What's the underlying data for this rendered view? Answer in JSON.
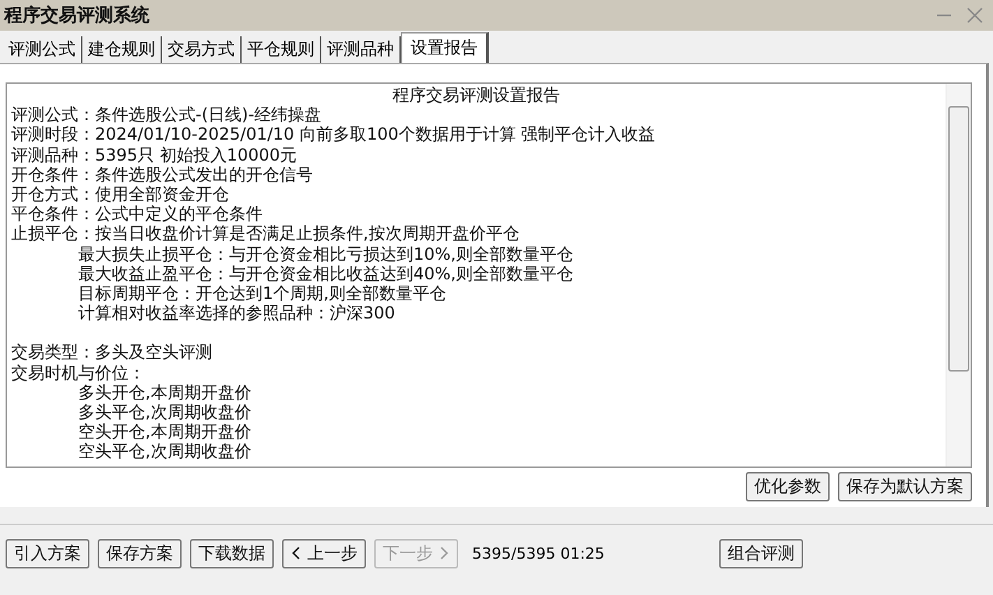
{
  "window": {
    "title": "程序交易评测系统"
  },
  "tabs": [
    {
      "label": "评测公式",
      "selected": false
    },
    {
      "label": "建仓规则",
      "selected": false
    },
    {
      "label": "交易方式",
      "selected": false
    },
    {
      "label": "平仓规则",
      "selected": false
    },
    {
      "label": "评测品种",
      "selected": false
    },
    {
      "label": "设置报告",
      "selected": true
    }
  ],
  "report": {
    "title": "程序交易评测设置报告",
    "groups": [
      [
        {
          "text": "评测公式：条件选股公式-(日线)-经纬操盘"
        },
        {
          "text": "评测时段：2024/01/10-2025/01/10 向前多取100个数据用于计算 强制平仓计入收益"
        },
        {
          "text": "评测品种：5395只 初始投入10000元"
        },
        {
          "text": "开仓条件：条件选股公式发出的开仓信号"
        },
        {
          "text": "开仓方式：使用全部资金开仓"
        },
        {
          "text": "平仓条件：公式中定义的平仓条件"
        },
        {
          "text": "止损平仓：按当日收盘价计算是否满足止损条件,按次周期开盘价平仓",
          "children": [
            {
              "text": "最大损失止损平仓：与开仓资金相比亏损达到10%,则全部数量平仓"
            },
            {
              "text": "最大收益止盈平仓：与开仓资金相比收益达到40%,则全部数量平仓"
            },
            {
              "text": "目标周期平仓：开仓达到1个周期,则全部数量平仓"
            },
            {
              "text": "计算相对收益率选择的参照品种：沪深300"
            }
          ]
        }
      ],
      [
        {
          "text": "交易类型：多头及空头评测"
        },
        {
          "text": "交易时机与价位：",
          "children": [
            {
              "text": "多头开仓,本周期开盘价"
            },
            {
              "text": "多头平仓,次周期收盘价"
            },
            {
              "text": "空头开仓,本周期开盘价"
            },
            {
              "text": "空头平仓,次周期收盘价"
            }
          ]
        }
      ]
    ]
  },
  "panel_buttons": [
    "优化参数",
    "保存为默认方案"
  ],
  "toolbar": [
    {
      "label": "引入方案",
      "kind": "plain",
      "disabled": false
    },
    {
      "label": "保存方案",
      "kind": "plain",
      "disabled": false
    },
    {
      "label": "下载数据",
      "kind": "plain",
      "disabled": false
    },
    {
      "label": "上一步",
      "kind": "back",
      "disabled": false
    },
    {
      "label": "下一步",
      "kind": "next",
      "disabled": true
    }
  ],
  "status": "5395/5395 01:25",
  "right_button": "组合评测"
}
